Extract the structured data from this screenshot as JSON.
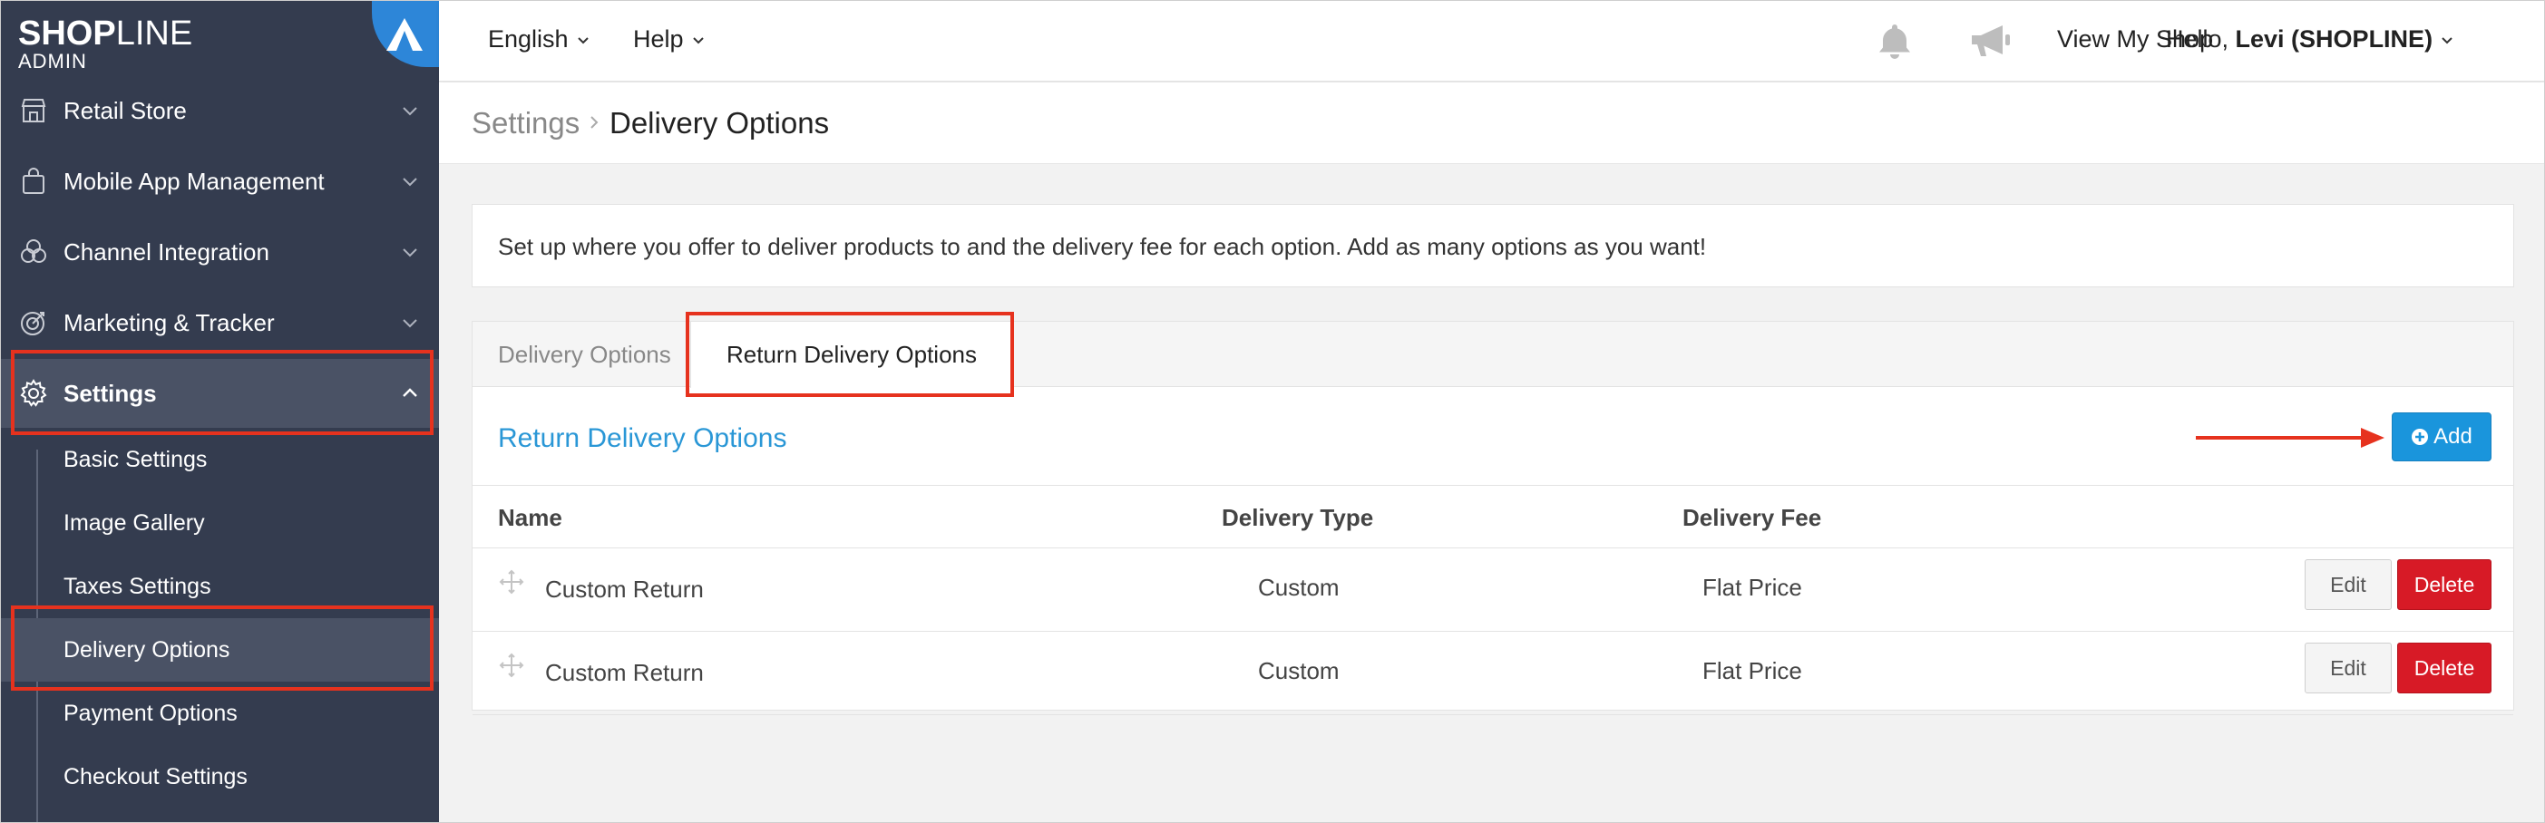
{
  "app": {
    "brand_bold": "SHOP",
    "brand_thin": "LINE",
    "brand_sub": "ADMIN"
  },
  "sidebar": {
    "items": [
      {
        "label": "Retail Store",
        "icon": "store-icon"
      },
      {
        "label": "Mobile App Management",
        "icon": "shopping-bag-icon"
      },
      {
        "label": "Channel Integration",
        "icon": "channels-icon"
      },
      {
        "label": "Marketing & Tracker",
        "icon": "target-icon"
      },
      {
        "label": "Settings",
        "icon": "gear-icon"
      }
    ],
    "sub_items": [
      {
        "label": "Basic Settings"
      },
      {
        "label": "Image Gallery"
      },
      {
        "label": "Taxes Settings"
      },
      {
        "label": "Delivery Options"
      },
      {
        "label": "Payment Options"
      },
      {
        "label": "Checkout Settings"
      }
    ]
  },
  "topbar": {
    "language": "English",
    "help": "Help",
    "view_shop": "View My Shop",
    "greeting": "Hello, ",
    "user": "Levi (SHOPLINE)"
  },
  "breadcrumb": {
    "root": "Settings",
    "current": "Delivery Options"
  },
  "main": {
    "info": "Set up where you offer to deliver products to and the delivery fee for each option. Add as many options as you want!",
    "tabs": [
      {
        "label": "Delivery Options"
      },
      {
        "label": "Return Delivery Options"
      }
    ],
    "section_title": "Return Delivery Options",
    "add_label": "Add",
    "table": {
      "headers": [
        "Name",
        "Delivery Type",
        "Delivery Fee"
      ],
      "rows": [
        {
          "name": "Custom Return",
          "type": "Custom",
          "fee": "Flat Price",
          "edit": "Edit",
          "delete": "Delete"
        },
        {
          "name": "Custom Return",
          "type": "Custom",
          "fee": "Flat Price",
          "edit": "Edit",
          "delete": "Delete"
        }
      ]
    }
  },
  "colors": {
    "sidebar_bg": "#343c4f",
    "accent_blue": "#1a95dc",
    "delete_red": "#d71a26",
    "highlight_red": "#e6321e"
  }
}
